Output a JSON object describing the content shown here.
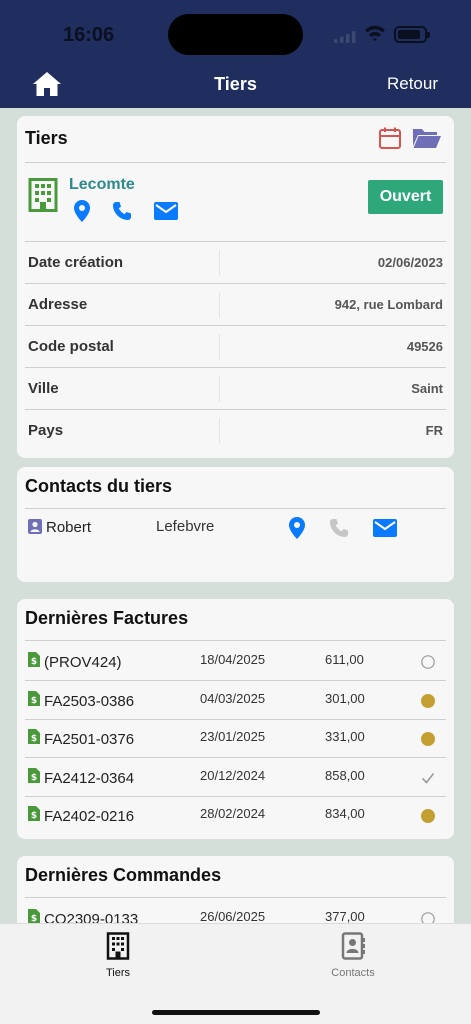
{
  "status_bar": {
    "time": "16:06"
  },
  "nav": {
    "title": "Tiers",
    "back_label": "Retour"
  },
  "tiers_card": {
    "title": "Tiers",
    "company_name": "Lecomte",
    "status_label": "Ouvert",
    "fields": [
      {
        "label": "Date création",
        "value": "02/06/2023"
      },
      {
        "label": "Adresse",
        "value": "942, rue Lombard"
      },
      {
        "label": "Code postal",
        "value": "49526"
      },
      {
        "label": "Ville",
        "value": "Saint"
      },
      {
        "label": "Pays",
        "value": "FR"
      }
    ]
  },
  "contacts_card": {
    "title": "Contacts du tiers",
    "contacts": [
      {
        "first_name": "Robert",
        "last_name": "Lefebvre"
      }
    ]
  },
  "factures_card": {
    "title": "Dernières Factures",
    "rows": [
      {
        "ref": "(PROV424)",
        "date": "18/04/2025",
        "amount": "611,00",
        "status": "draft"
      },
      {
        "ref": "FA2503-0386",
        "date": "04/03/2025",
        "amount": "301,00",
        "status": "unpaid"
      },
      {
        "ref": "FA2501-0376",
        "date": "23/01/2025",
        "amount": "331,00",
        "status": "unpaid"
      },
      {
        "ref": "FA2412-0364",
        "date": "20/12/2024",
        "amount": "858,00",
        "status": "paid"
      },
      {
        "ref": "FA2402-0216",
        "date": "28/02/2024",
        "amount": "834,00",
        "status": "unpaid"
      }
    ]
  },
  "commandes_card": {
    "title": "Dernières Commandes",
    "rows": [
      {
        "ref": "CO2309-0133",
        "date": "26/06/2025",
        "amount": "377,00",
        "status": "draft"
      }
    ]
  },
  "tabbar": {
    "tabs": [
      {
        "label": "Tiers",
        "active": true
      },
      {
        "label": "Contacts",
        "active": false
      }
    ]
  },
  "colors": {
    "header_bg": "#1f2e5f",
    "status_open": "#2ea87b",
    "company_name": "#2e8a8c",
    "status_unpaid": "#c4a032",
    "link_blue": "#0a7aff",
    "calendar_red": "#d9534f",
    "folder_purple": "#6f6fb8",
    "invoice_green": "#4a9a3c"
  }
}
